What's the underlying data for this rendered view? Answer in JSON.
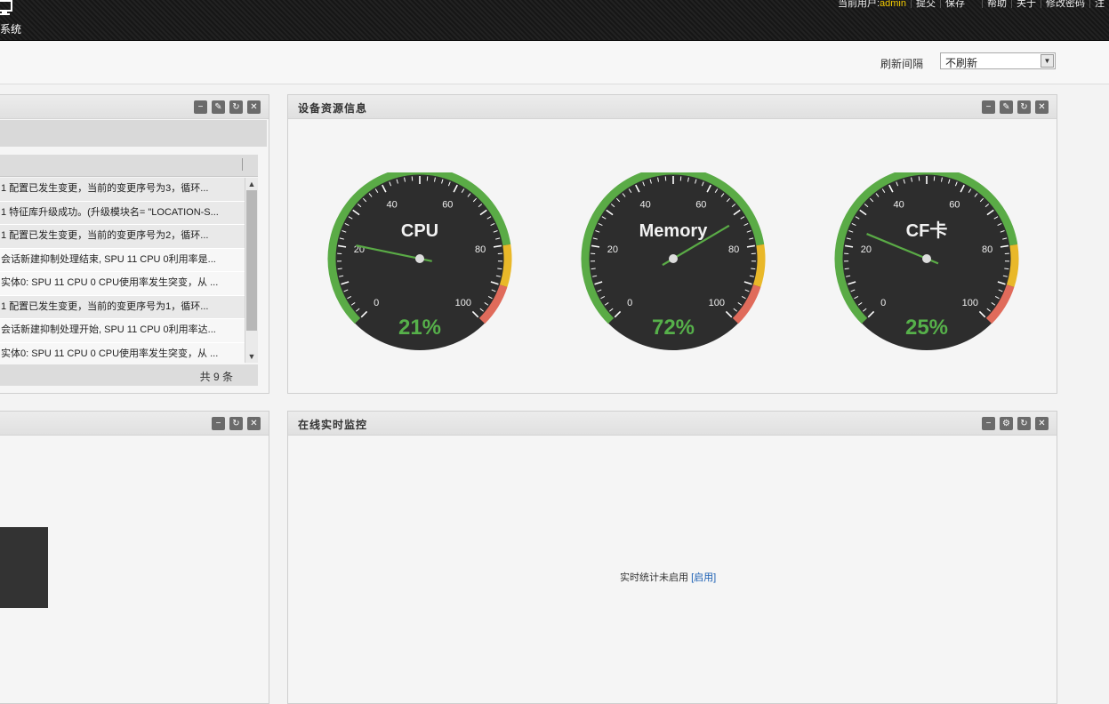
{
  "topbar": {
    "system_label": "系统",
    "current_user_label": "当前用户:",
    "current_user": "admin",
    "links": [
      "提交",
      "保存",
      "帮助",
      "关于",
      "修改密码",
      "注"
    ]
  },
  "toolbar": {
    "refresh_label": "刷新间隔",
    "refresh_value": "不刷新"
  },
  "log_panel": {
    "rows": [
      "1 配置已发生变更，当前的变更序号为3，循环...",
      "1 特征库升级成功。(升级模块名= \"LOCATION-S...",
      "1 配置已发生变更，当前的变更序号为2，循环...",
      "会话新建抑制处理结束, SPU 11 CPU 0利用率是...",
      "实体0: SPU 11 CPU 0 CPU使用率发生突变，从 ...",
      "1 配置已发生变更，当前的变更序号为1，循环...",
      "会话新建抑制处理开始, SPU 11 CPU 0利用率达...",
      "实体0: SPU 11 CPU 0 CPU使用率发生突变，从 ..."
    ],
    "footer": "共 9 条"
  },
  "resource_panel": {
    "title": "设备资源信息",
    "gauges": [
      {
        "label": "CPU",
        "value": 21,
        "display": "21%"
      },
      {
        "label": "Memory",
        "value": 72,
        "display": "72%"
      },
      {
        "label": "CF卡",
        "value": 25,
        "display": "25%"
      }
    ],
    "ticks": [
      "0",
      "20",
      "40",
      "60",
      "80",
      "100"
    ]
  },
  "monitor_panel": {
    "title": "在线实时监控",
    "status": "实时统计未启用",
    "enable_link": "[启用]"
  },
  "colors": {
    "gauge_green": "#5aab46",
    "gauge_yellow": "#e9b829",
    "gauge_red": "#e06b5b",
    "value_text": "#56b04a"
  }
}
